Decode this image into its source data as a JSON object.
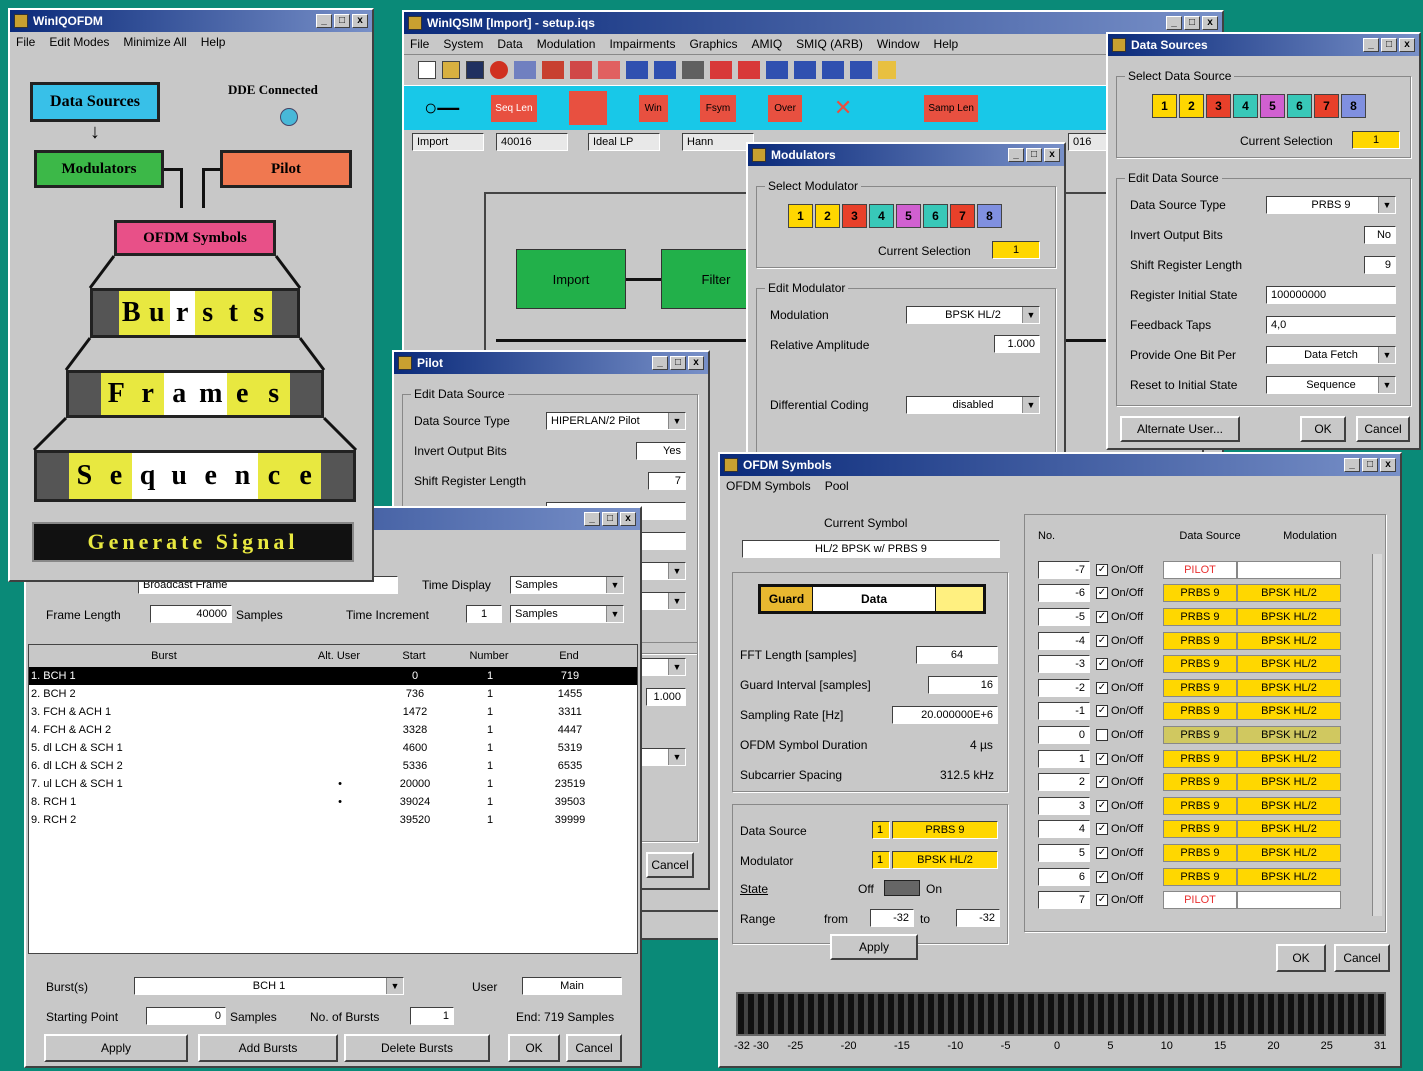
{
  "wingofdm": {
    "title": "WinIQOFDM",
    "menu": [
      "File",
      "Edit Modes",
      "Minimize All",
      "Help"
    ],
    "data_sources": "Data Sources",
    "dde": "DDE Connected",
    "modulators": "Modulators",
    "pilot": "Pilot",
    "ofdm_symbols": "OFDM Symbols",
    "bursts": [
      "B",
      "u",
      "r",
      "s",
      "t",
      "s"
    ],
    "frames": [
      "F",
      "r",
      "a",
      "m",
      "e",
      "s"
    ],
    "sequence": [
      "S",
      "e",
      "q",
      "u",
      "e",
      "n",
      "c",
      "e"
    ],
    "generate": "Generate Signal"
  },
  "main": {
    "title": "WinIQSIM [Import] - setup.iqs",
    "menu": [
      "File",
      "System",
      "Data",
      "Modulation",
      "Impairments",
      "Graphics",
      "AMIQ",
      "SMIQ (ARB)",
      "Window",
      "Help"
    ],
    "tools": [
      "Seq Len",
      "Win",
      "Fsym",
      "Over",
      "Samp Len"
    ],
    "fields": [
      "Import",
      "40016",
      "Ideal LP",
      "Hann"
    ],
    "field_right": "016",
    "blocks": [
      "Import",
      "Filter"
    ]
  },
  "datasrc": {
    "title": "Data Sources",
    "select": "Select Data Source",
    "nums": [
      "1",
      "2",
      "3",
      "4",
      "5",
      "6",
      "7",
      "8"
    ],
    "cur_label": "Current Selection",
    "cur": "1",
    "edit": "Edit Data Source",
    "rows": [
      {
        "l": "Data Source Type",
        "v": "PRBS 9"
      },
      {
        "l": "Invert Output Bits",
        "v": "No"
      },
      {
        "l": "Shift Register Length",
        "v": "9"
      },
      {
        "l": "Register Initial State",
        "v": "100000000"
      },
      {
        "l": "Feedback Taps",
        "v": "4,0"
      },
      {
        "l": "Provide One Bit Per",
        "v": "Data Fetch"
      },
      {
        "l": "Reset to Initial State",
        "v": "Sequence"
      }
    ],
    "alt": "Alternate User...",
    "ok": "OK",
    "cancel": "Cancel"
  },
  "modwin": {
    "title": "Modulators",
    "select": "Select Modulator",
    "cur_label": "Current Selection",
    "cur": "1",
    "edit": "Edit Modulator",
    "mod_l": "Modulation",
    "mod_v": "BPSK HL/2",
    "amp_l": "Relative Amplitude",
    "amp_v": "1.000",
    "diff_l": "Differential Coding",
    "diff_v": "disabled"
  },
  "pilotwin": {
    "title": "Pilot",
    "edit": "Edit Data Source",
    "type_l": "Data Source Type",
    "type_v": "HIPERLAN/2 Pilot",
    "inv_l": "Invert Output Bits",
    "inv_v": "Yes",
    "shift_l": "Shift Register Length",
    "shift_v": "7",
    "amp": "1.000",
    "cancel": "Cancel"
  },
  "frame": {
    "frame_name_v": "Broadcast Frame",
    "time_display_l": "Time Display",
    "time_display_v": "Samples",
    "frame_len_l": "Frame Length",
    "frame_len_v": "40000",
    "samples": "Samples",
    "time_inc_l": "Time Increment",
    "time_inc_v": "1",
    "time_inc_u": "Samples",
    "headers": [
      "Burst",
      "Alt. User",
      "Start",
      "Number",
      "End"
    ],
    "rows": [
      {
        "b": "1. BCH 1",
        "u": "",
        "s": "0",
        "n": "1",
        "e": "719"
      },
      {
        "b": "2. BCH 2",
        "u": "",
        "s": "736",
        "n": "1",
        "e": "1455"
      },
      {
        "b": "3. FCH & ACH 1",
        "u": "",
        "s": "1472",
        "n": "1",
        "e": "3311"
      },
      {
        "b": "4. FCH & ACH 2",
        "u": "",
        "s": "3328",
        "n": "1",
        "e": "4447"
      },
      {
        "b": "5. dl LCH & SCH 1",
        "u": "",
        "s": "4600",
        "n": "1",
        "e": "5319"
      },
      {
        "b": "6. dl LCH & SCH 2",
        "u": "",
        "s": "5336",
        "n": "1",
        "e": "6535"
      },
      {
        "b": "7. ul LCH & SCH 1",
        "u": "•",
        "s": "20000",
        "n": "1",
        "e": "23519"
      },
      {
        "b": "8. RCH 1",
        "u": "•",
        "s": "39024",
        "n": "1",
        "e": "39503"
      },
      {
        "b": "9. RCH 2",
        "u": "",
        "s": "39520",
        "n": "1",
        "e": "39999"
      }
    ],
    "burst_l": "Burst(s)",
    "burst_v": "BCH 1",
    "user_l": "User",
    "user_v": "Main",
    "start_l": "Starting Point",
    "start_v": "0",
    "start_u": "Samples",
    "nob_l": "No. of Bursts",
    "nob_v": "1",
    "end": "End: 719 Samples",
    "apply": "Apply",
    "add": "Add Bursts",
    "del": "Delete Bursts",
    "ok": "OK",
    "cancel": "Cancel"
  },
  "ofdm": {
    "title": "OFDM Symbols",
    "menu": [
      "OFDM Symbols",
      "Pool"
    ],
    "cur_label": "Current Symbol",
    "cur": "HL/2 BPSK w/ PRBS 9",
    "guard": "Guard",
    "data": "Data",
    "params": [
      {
        "l": "FFT Length [samples]",
        "v": "64"
      },
      {
        "l": "Guard Interval [samples]",
        "v": "16"
      },
      {
        "l": "Sampling Rate [Hz]",
        "v": "20.000000E+6"
      },
      {
        "l": "OFDM Symbol Duration",
        "v": "4 µs"
      },
      {
        "l": "Subcarrier Spacing",
        "v": "312.5 kHz"
      }
    ],
    "ds_l": "Data Source",
    "ds_n": "1",
    "ds_v": "PRBS 9",
    "mod_l": "Modulator",
    "mod_n": "1",
    "mod_v": "BPSK HL/2",
    "state_l": "State",
    "off": "Off",
    "on": "On",
    "range_l": "Range",
    "from": "from",
    "from_v": "-32",
    "to": "to",
    "to_v": "-32",
    "apply": "Apply",
    "th": [
      "No.",
      "Data Source",
      "Modulation"
    ],
    "onoff": "On/Off",
    "rows": [
      {
        "n": "-7",
        "ds": "PILOT",
        "m": "",
        "c": true
      },
      {
        "n": "-6",
        "ds": "PRBS 9",
        "m": "BPSK HL/2",
        "c": true
      },
      {
        "n": "-5",
        "ds": "PRBS 9",
        "m": "BPSK HL/2",
        "c": true
      },
      {
        "n": "-4",
        "ds": "PRBS 9",
        "m": "BPSK HL/2",
        "c": true
      },
      {
        "n": "-3",
        "ds": "PRBS 9",
        "m": "BPSK HL/2",
        "c": true
      },
      {
        "n": "-2",
        "ds": "PRBS 9",
        "m": "BPSK HL/2",
        "c": true
      },
      {
        "n": "-1",
        "ds": "PRBS 9",
        "m": "BPSK HL/2",
        "c": true
      },
      {
        "n": "0",
        "ds": "PRBS 9",
        "m": "BPSK HL/2",
        "c": false
      },
      {
        "n": "1",
        "ds": "PRBS 9",
        "m": "BPSK HL/2",
        "c": true
      },
      {
        "n": "2",
        "ds": "PRBS 9",
        "m": "BPSK HL/2",
        "c": true
      },
      {
        "n": "3",
        "ds": "PRBS 9",
        "m": "BPSK HL/2",
        "c": true
      },
      {
        "n": "4",
        "ds": "PRBS 9",
        "m": "BPSK HL/2",
        "c": true
      },
      {
        "n": "5",
        "ds": "PRBS 9",
        "m": "BPSK HL/2",
        "c": true
      },
      {
        "n": "6",
        "ds": "PRBS 9",
        "m": "BPSK HL/2",
        "c": true
      },
      {
        "n": "7",
        "ds": "PILOT",
        "m": "",
        "c": true
      }
    ],
    "ok": "OK",
    "cancel": "Cancel",
    "ticks": [
      "-32 -30",
      "-25",
      "-20",
      "-15",
      "-10",
      "-5",
      "0",
      "5",
      "10",
      "15",
      "20",
      "25",
      "31"
    ]
  },
  "colors": {
    "n": [
      "#ffd700",
      "#ffd700",
      "#e8402a",
      "#38c8b8",
      "#d060d0",
      "#38c8b8",
      "#e8402a",
      "#8090e0"
    ]
  }
}
